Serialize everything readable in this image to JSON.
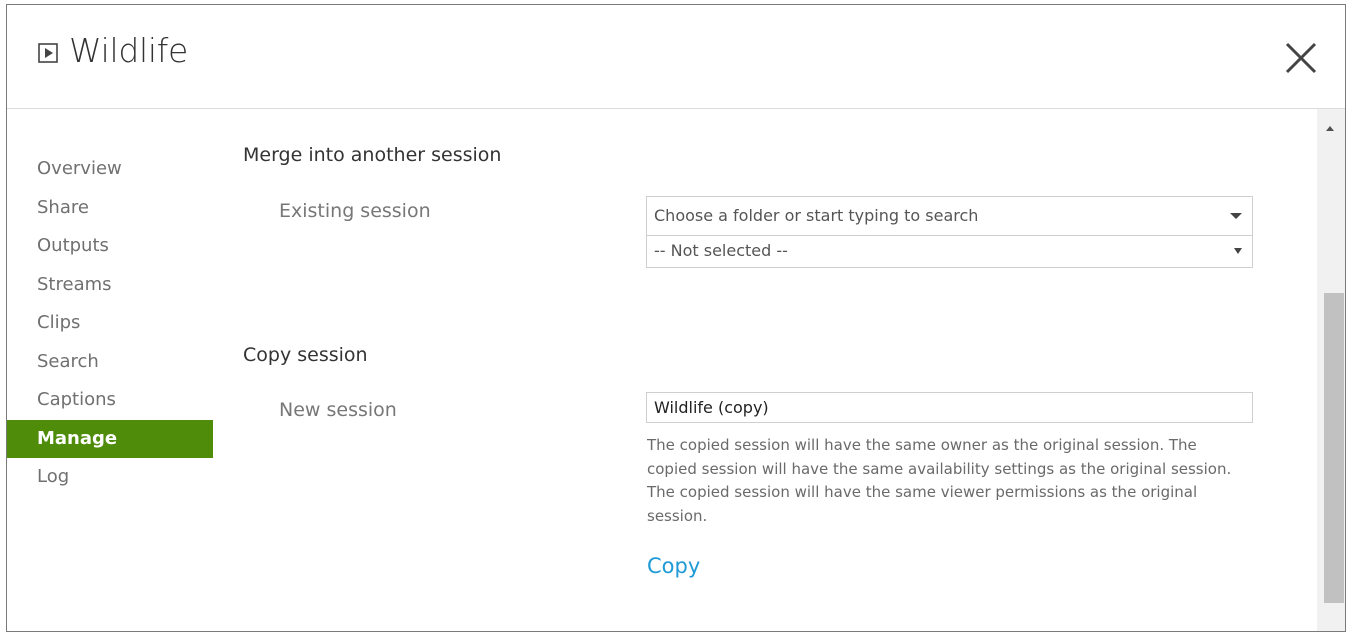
{
  "header": {
    "title": "Wildlife",
    "title_icon": "play-box-icon",
    "close_icon": "close-icon"
  },
  "sidebar": {
    "items": [
      {
        "label": "Overview"
      },
      {
        "label": "Share"
      },
      {
        "label": "Outputs"
      },
      {
        "label": "Streams"
      },
      {
        "label": "Clips"
      },
      {
        "label": "Search"
      },
      {
        "label": "Captions"
      },
      {
        "label": "Manage",
        "active": true
      },
      {
        "label": "Log"
      }
    ],
    "active_color": "#4e8c0a"
  },
  "merge": {
    "title": "Merge into another session",
    "field_label": "Existing session",
    "folder_placeholder": "Choose a folder or start typing to search",
    "session_select_value": "-- Not selected --"
  },
  "copy": {
    "title": "Copy session",
    "field_label": "New session",
    "input_value": "Wildlife (copy)",
    "help_text": "The copied session will have the same owner as the original session. The copied session will have the same availability settings as the original session. The copied session will have the same viewer permissions as the original session.",
    "action_label": "Copy",
    "link_color": "#1e9ad6"
  }
}
